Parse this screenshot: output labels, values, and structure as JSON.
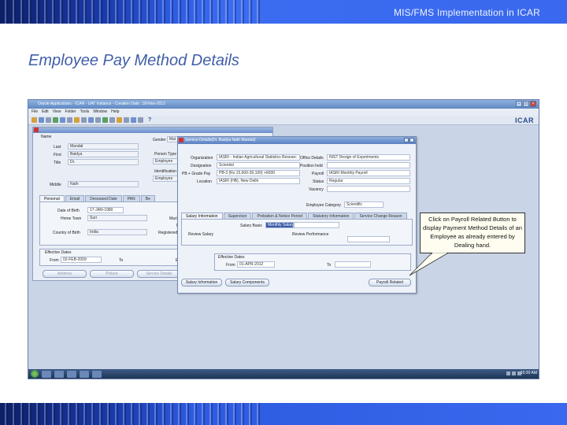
{
  "header": {
    "title": "MIS/FMS Implementation in ICAR"
  },
  "slide": {
    "title": "Employee Pay Method Details"
  },
  "app": {
    "window_title": "Oracle Applications - ICAR - UAT Instance - Creation Date : 30-Nov-2012",
    "logo": "ICAR",
    "menu": [
      "File",
      "Edit",
      "View",
      "Folder",
      "Tools",
      "Window",
      "Help"
    ],
    "help_icon": "?"
  },
  "people_form": {
    "name_section": "Name",
    "labels": {
      "last": "Last",
      "first": "First",
      "title": "Title",
      "middle": "Middle",
      "gender": "Gender",
      "person_type": "Person Type",
      "identification": "Identification"
    },
    "values": {
      "last": "Mandal",
      "first": "Baidya",
      "title": "Dr.",
      "middle": "Nath",
      "gender": "Mal",
      "person_type": "Employee",
      "identification": "Employee"
    },
    "tabs": [
      "Personal",
      "Email",
      "Deceased Date",
      "PAN",
      "Be"
    ],
    "personal": {
      "dob_label": "Date of Birth",
      "dob": "17-JAN-1980",
      "home_town_label": "Home Town",
      "home_town": "Suri",
      "country_label": "Country of Birth",
      "country": "India",
      "marital_label": "Mari",
      "n_label": "N",
      "registered_label": "Registered"
    },
    "effective": {
      "section": "Effective Dates",
      "from_label": "From",
      "from": "02-FEB-2009",
      "to_label": "To",
      "e_label": "E"
    },
    "buttons": {
      "address": "Address",
      "picture": "Picture",
      "service": "Service Details"
    }
  },
  "service_form": {
    "title": "Service Details(Dr. Baidya Nath Mandal)",
    "labels": {
      "organization": "Organization",
      "designation": "Designation",
      "pb_grade": "PB + Grade Pay",
      "location": "Location",
      "office_details": "Office Details",
      "position_held": "Position held",
      "payroll": "Payroll",
      "status": "Status",
      "vacancy": "Vacancy",
      "employee_category": "Employee Category"
    },
    "values": {
      "organization": "IASRI - Indian Agricultural Statistics Researc",
      "designation": "Scientist",
      "pb_grade": "PB-3 (Rs 15,600-39,100) +6000",
      "location": "IASRI (HB), New Delhi",
      "office_details": "INST Design of Experiments",
      "payroll": "IASRI Monthly Payroll",
      "status": "Regular",
      "employee_category": "Scientific"
    },
    "tabs": [
      "Salary Information",
      "Supervisor",
      "Probation & Notice Period",
      "Statutory Information",
      "Service Change Reason"
    ],
    "salary": {
      "basis_label": "Salary Basis",
      "basis": "Monthly Salary",
      "review_label": "Review Salary",
      "performance_label": "Review Performance"
    },
    "effective": {
      "section": "Effective Dates",
      "from_label": "From",
      "from": "01-APR-2012",
      "to_label": "To"
    },
    "buttons": {
      "salary_info": "Salary Information",
      "salary_components": "Salary Components",
      "payroll_related": "Payroll Related"
    }
  },
  "taskbar": {
    "clock": "10:30 AM"
  },
  "callout": {
    "text": "Click on Payroll Related Button to display Payment Method Details of an Employee as already entered by Dealing hand."
  }
}
